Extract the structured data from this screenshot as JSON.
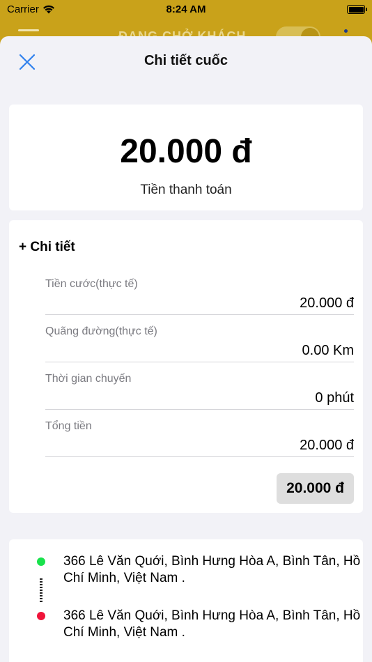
{
  "status_bar": {
    "carrier": "Carrier",
    "time": "8:24 AM"
  },
  "background": {
    "title": "ĐANG CHỞ KHÁCH"
  },
  "sheet": {
    "title": "Chi tiết cuốc",
    "close_icon": "close-icon"
  },
  "summary": {
    "amount": "20.000 đ",
    "caption": "Tiền thanh toán"
  },
  "details": {
    "heading": "+ Chi tiết",
    "rows": [
      {
        "label": "Tiền cước(thực tế)",
        "value": "20.000 đ"
      },
      {
        "label": "Quãng đường(thực tế)",
        "value": "0.00 Km"
      },
      {
        "label": "Thời gian chuyến",
        "value": "0 phút"
      },
      {
        "label": "Tổng tiền",
        "value": "20.000 đ"
      }
    ],
    "total": "20.000 đ"
  },
  "route": {
    "pickup": "366 Lê Văn Quới, Bình Hưng Hòa A, Bình Tân, Hồ Chí Minh, Việt Nam .",
    "dropoff": "366 Lê Văn Quới, Bình Hưng Hòa A, Bình Tân, Hồ Chí Minh, Việt Nam .",
    "pickup_color": "#19e24c",
    "dropoff_color": "#f0143a"
  },
  "colors": {
    "accent": "#2f80ed",
    "brand": "#c9a21a"
  }
}
